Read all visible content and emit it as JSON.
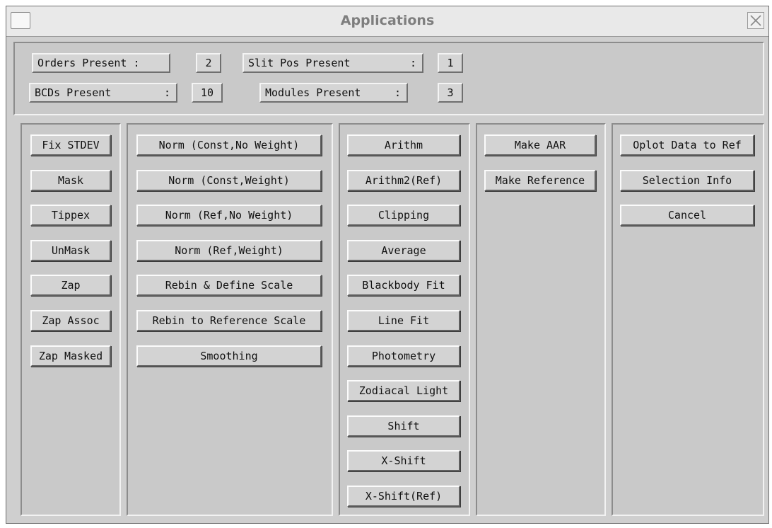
{
  "window": {
    "title": "Applications"
  },
  "status": {
    "orders_label": "Orders Present :",
    "orders_value": "2",
    "slit_label": "Slit Pos Present",
    "slit_value": "1",
    "bcds_label": "BCDs Present",
    "bcds_value": "10",
    "modules_label": "Modules Present",
    "modules_value": "3",
    "colon": ":"
  },
  "panels": [
    {
      "buttons": [
        "Fix STDEV",
        "Mask",
        "Tippex",
        "UnMask",
        "Zap",
        "Zap Assoc",
        "Zap Masked"
      ]
    },
    {
      "buttons": [
        "Norm (Const,No Weight)",
        "Norm (Const,Weight)",
        "Norm (Ref,No Weight)",
        "Norm (Ref,Weight)",
        "Rebin & Define Scale",
        "Rebin to Reference Scale",
        "Smoothing"
      ]
    },
    {
      "buttons": [
        "Arithm",
        "Arithm2(Ref)",
        "Clipping",
        "Average",
        "Blackbody Fit",
        "Line Fit",
        "Photometry",
        "Zodiacal Light",
        "Shift",
        "X-Shift",
        "X-Shift(Ref)"
      ]
    },
    {
      "buttons": [
        "Make AAR",
        "Make Reference"
      ]
    },
    {
      "buttons": [
        "Oplot Data to Ref",
        "Selection Info",
        "Cancel"
      ]
    }
  ]
}
